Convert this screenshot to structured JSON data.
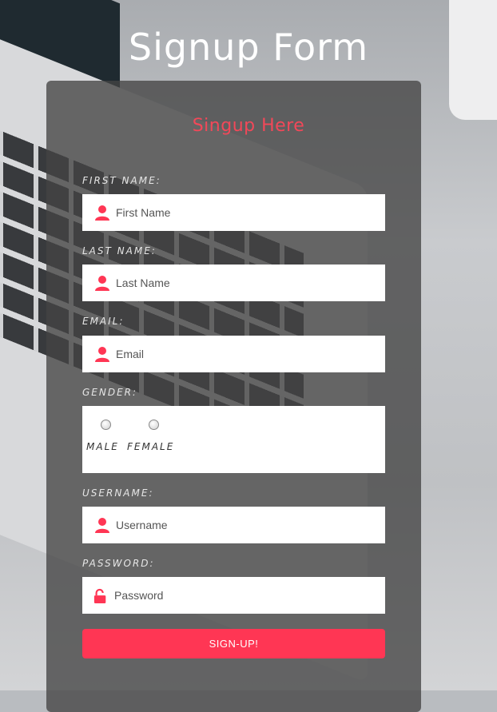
{
  "page": {
    "title": "Signup Form"
  },
  "form": {
    "heading": "Singup Here",
    "first_name": {
      "label": "FIRST NAME:",
      "placeholder": "First Name",
      "value": ""
    },
    "last_name": {
      "label": "LAST NAME:",
      "placeholder": "Last Name",
      "value": ""
    },
    "email": {
      "label": "EMAIL:",
      "placeholder": "Email",
      "value": ""
    },
    "gender": {
      "label": "GENDER:",
      "options": [
        {
          "label": "MALE"
        },
        {
          "label": "FEMALE"
        }
      ]
    },
    "username": {
      "label": "USERNAME:",
      "placeholder": "Username",
      "value": ""
    },
    "password": {
      "label": "PASSWORD:",
      "placeholder": "Password",
      "value": ""
    },
    "submit_label": "SIGN-UP!"
  },
  "colors": {
    "accent": "#ff3654",
    "heading": "#f24859",
    "card": "#444444",
    "input_bg": "#ffffff"
  },
  "icons": {
    "user": "user-icon",
    "lock": "unlock-icon"
  }
}
